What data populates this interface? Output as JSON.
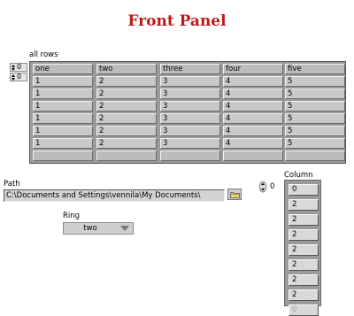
{
  "title": "Front Panel",
  "array": {
    "label": "all rows",
    "row_index": "0",
    "col_index": "0",
    "headers": [
      "one",
      "two",
      "three",
      "four",
      "five"
    ],
    "rows": [
      [
        "1",
        "2",
        "3",
        "4",
        "5"
      ],
      [
        "1",
        "2",
        "3",
        "4",
        "5"
      ],
      [
        "1",
        "2",
        "3",
        "4",
        "5"
      ],
      [
        "1",
        "2",
        "3",
        "4",
        "5"
      ],
      [
        "1",
        "2",
        "3",
        "4",
        "5"
      ],
      [
        "1",
        "2",
        "3",
        "4",
        "5"
      ]
    ]
  },
  "path": {
    "label": "Path",
    "value": "C:\\Documents and Settings\\vennila\\My Documents\\",
    "browse_icon": "folder-icon"
  },
  "ring": {
    "label": "Ring",
    "value": "two"
  },
  "column": {
    "label": "Column",
    "index": "0",
    "values": [
      "0",
      "2",
      "2",
      "2",
      "2",
      "2",
      "2",
      "2"
    ],
    "ghost_value": "0"
  }
}
